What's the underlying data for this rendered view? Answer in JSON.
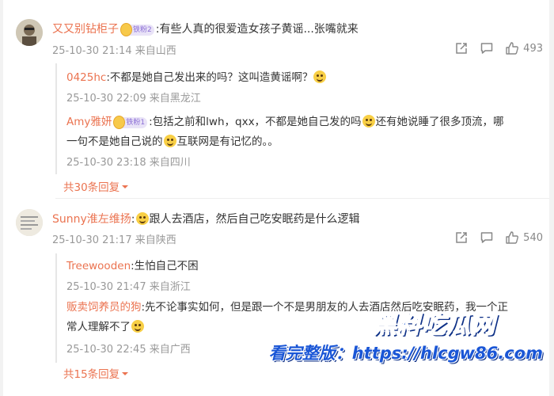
{
  "comments": [
    {
      "name": "又又别钻柜子",
      "badge": "铁粉2",
      "text": ":有些人真的很爱造女孩子黄谣...张嘴就来",
      "time": "25-10-30 21:14 来自山西",
      "likes": "493",
      "replies": [
        {
          "name": "0425hc",
          "text": ":不都是她自己发出来的吗？这叫造黄谣啊？",
          "time": "25-10-30 22:09 来自黑龙江"
        },
        {
          "name": "Amy雅妍",
          "badge": "铁粉1",
          "text1": ":包括之前和lwh，qxx，不都是她自己发的吗",
          "text2": "还有她说睡了很多顶流，哪",
          "text3": "一句不是她自己说的",
          "text4": "互联网是有记忆的。。",
          "time": "25-10-30 23:18 来自四川"
        }
      ],
      "more": "共30条回复"
    },
    {
      "name": "Sunny淮左维扬",
      "text": "跟人去酒店，然后自己吃安眠药是什么逻辑",
      "time": "25-10-30 21:17 来自陕西",
      "likes": "540",
      "replies": [
        {
          "name": "Treewooden",
          "text": ":生怕自己不困",
          "time": "25-10-30 21:47 来自浙江"
        },
        {
          "name": "贩卖饲养员的狗",
          "text1": ":先不论事实如何，但是跟一个不是男朋友的人去酒店然后吃安眠药，我一个正",
          "text2": "常人理解不了",
          "time": "25-10-30 22:45 来自广西"
        }
      ],
      "more": "共15条回复"
    }
  ],
  "watermark": {
    "title": "黑料吃瓜网",
    "url": "看完整版：https://hlcgw86.com"
  },
  "icons": [
    "share-icon",
    "comment-icon",
    "like-icon",
    "chevron-down-icon"
  ]
}
